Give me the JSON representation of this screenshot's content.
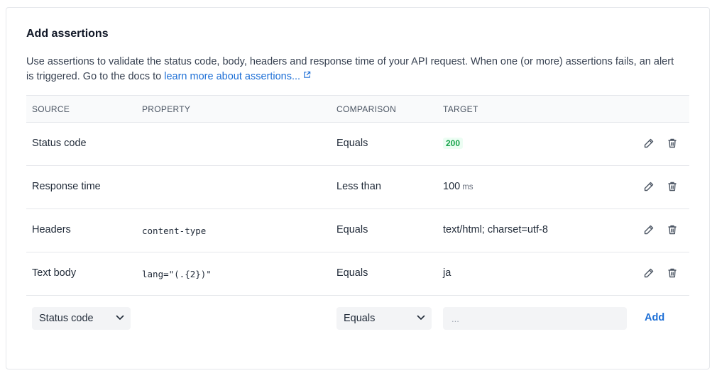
{
  "section": {
    "title": "Add assertions",
    "description": "Use assertions to validate the status code, body, headers and response time of your API request. When one (or more) assertions fails, an alert is triggered. Go to the docs to ",
    "link_text": "learn more about assertions...",
    "link_icon": "external-link-icon"
  },
  "table": {
    "headers": {
      "source": "SOURCE",
      "property": "PROPERTY",
      "comparison": "COMPARISON",
      "target": "TARGET"
    },
    "rows": [
      {
        "source": "Status code",
        "property": "",
        "comparison": "Equals",
        "target": "200",
        "target_unit": ""
      },
      {
        "source": "Response time",
        "property": "",
        "comparison": "Less than",
        "target": "100",
        "target_unit": "ms"
      },
      {
        "source": "Headers",
        "property": "content-type",
        "comparison": "Equals",
        "target": "text/html; charset=utf-8",
        "target_unit": ""
      },
      {
        "source": "Text body",
        "property": "lang=\"(.{2})\"",
        "comparison": "Equals",
        "target": "ja",
        "target_unit": ""
      }
    ],
    "row_actions": {
      "edit_icon": "pencil-icon",
      "delete_icon": "trash-icon"
    }
  },
  "new_assertion": {
    "source_selected": "Status code",
    "comparison_selected": "Equals",
    "target_placeholder": "...",
    "target_value": "",
    "add_label": "Add"
  },
  "colors": {
    "link": "#1d6fd6",
    "success_badge_bg": "#ecfdf3",
    "success_badge_text": "#16a34a"
  }
}
